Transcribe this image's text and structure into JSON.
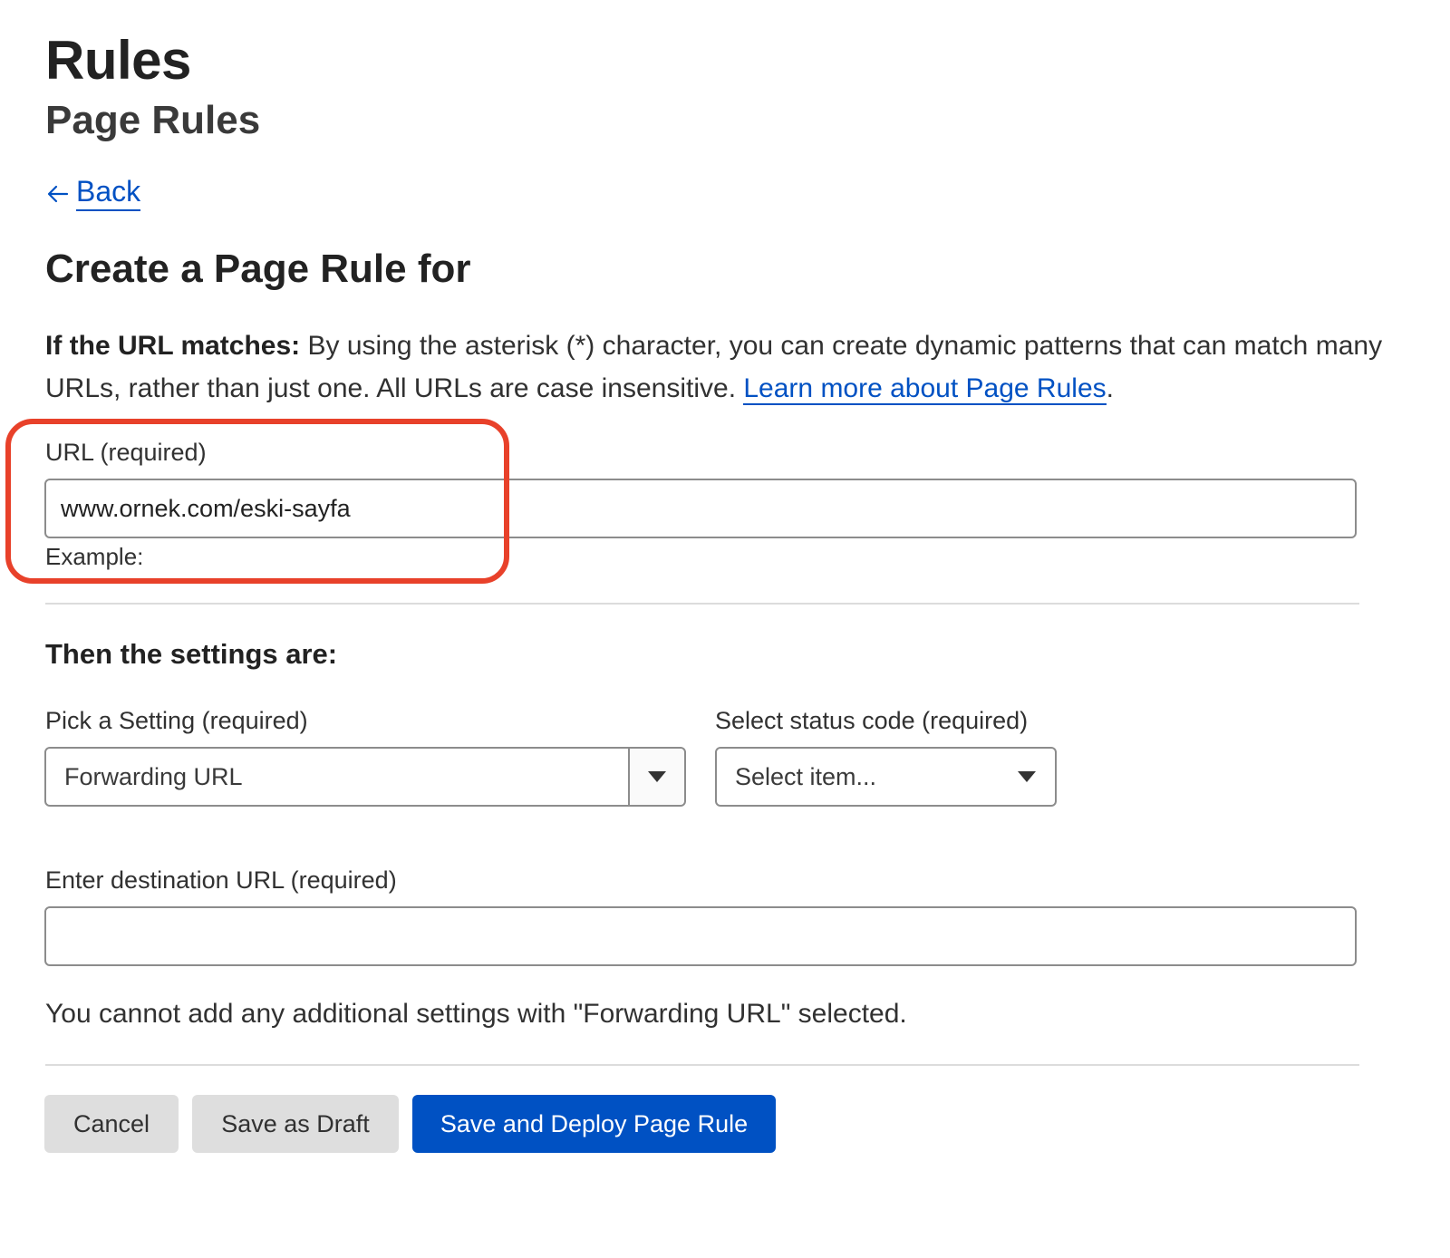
{
  "header": {
    "title": "Rules",
    "subtitle": "Page Rules"
  },
  "nav": {
    "back_label": "Back",
    "back_icon": "arrow-left-icon"
  },
  "form": {
    "heading": "Create a Page Rule for",
    "description_bold": "If the URL matches:",
    "description_text": " By using the asterisk (*) character, you can create dynamic patterns that can match many URLs, rather than just one. All URLs are case insensitive. ",
    "learn_more_label": "Learn more about Page Rules",
    "description_end": ".",
    "url_field": {
      "label": "URL (required)",
      "value": "www.ornek.com/eski-sayfa",
      "hint": "Example:"
    },
    "highlight_color": "#e8412a",
    "settings_heading": "Then the settings are:",
    "setting_select": {
      "label": "Pick a Setting (required)",
      "value": "Forwarding URL",
      "icon": "caret-down-icon"
    },
    "status_select": {
      "label": "Select status code (required)",
      "value": "Select item...",
      "icon": "caret-down-icon"
    },
    "destination_field": {
      "label": "Enter destination URL (required)",
      "value": ""
    },
    "info_text": "You cannot add any additional settings with \"Forwarding URL\" selected."
  },
  "actions": {
    "cancel_label": "Cancel",
    "draft_label": "Save as Draft",
    "deploy_label": "Save and Deploy Page Rule",
    "primary_color": "#0051c3"
  }
}
